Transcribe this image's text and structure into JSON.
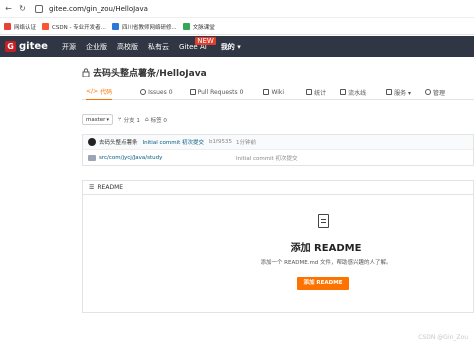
{
  "browser": {
    "url": "gitee.com/gin_zou/HelloJava",
    "bookmarks": [
      {
        "label": "网络认证",
        "color": "#e94235"
      },
      {
        "label": "CSDN - 专业开发者...",
        "color": "#fc5531"
      },
      {
        "label": "四川省教师网络研修...",
        "color": "#2b7bd6"
      },
      {
        "label": "文脉课堂",
        "color": "#35a853"
      }
    ]
  },
  "header": {
    "logo_text": "gitee",
    "nav": [
      "开源",
      "企业版",
      "高校版",
      "私有云"
    ],
    "ai_label": "Gitee AI",
    "new_badge": "NEW",
    "mine_label": "我的 ▾"
  },
  "repo": {
    "title": "去码头整点薯条/HelloJava"
  },
  "tabs": [
    {
      "label": "代码",
      "icon": "code-icon",
      "active": true
    },
    {
      "label": "Issues",
      "icon": "issues-icon",
      "count": "0"
    },
    {
      "label": "Pull Requests",
      "icon": "pull-request-icon",
      "count": "0"
    },
    {
      "label": "Wiki",
      "icon": "wiki-icon"
    },
    {
      "label": "统计",
      "icon": "stats-icon"
    },
    {
      "label": "流水线",
      "icon": "pipeline-icon"
    },
    {
      "label": "服务 ▾",
      "icon": "service-icon"
    },
    {
      "label": "管理",
      "icon": "settings-icon"
    }
  ],
  "branch_bar": {
    "branch": "master",
    "branch_count": "分支 1",
    "tag_count": "标签 0"
  },
  "latest_commit": {
    "author": "去码头整点薯条",
    "message": "Initial commit 初次提交",
    "sha": "b1f9535",
    "time": "1分钟前"
  },
  "files": [
    {
      "path": "src/com/jycj/Java/study",
      "commit": "Initial commit 初次提交"
    }
  ],
  "readme": {
    "header": "README",
    "title": "添加 README",
    "description": "添加一个 README.md 文件，帮助感兴趣的人了解。",
    "button": "添加 README"
  },
  "watermark": "CSDN @Gin_Zou",
  "colors": {
    "brand_dark": "#303643",
    "accent": "#fe7300",
    "logo_red": "#c71d23"
  }
}
